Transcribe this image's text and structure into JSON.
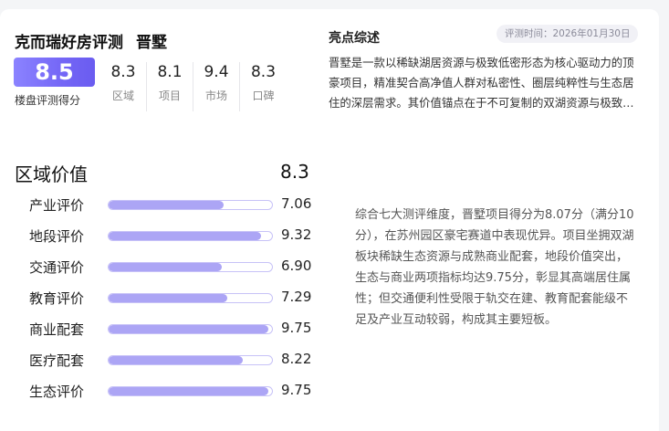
{
  "header": {
    "title": "克而瑞好房评测",
    "project": "晋墅",
    "overall_score": "8.5",
    "overall_caption": "楼盘评测得分",
    "subscores": [
      {
        "value": "8.3",
        "label": "区域"
      },
      {
        "value": "8.1",
        "label": "项目"
      },
      {
        "value": "9.4",
        "label": "市场"
      },
      {
        "value": "8.3",
        "label": "口碑"
      }
    ]
  },
  "highlights": {
    "title": "亮点综述",
    "eval_time": "评测时间：2026年01月30日",
    "text": "晋墅是一款以稀缺湖居资源与极致低密形态为核心驱动力的顶豪项目，精准契合高净值人群对私密性、圈层纯粹性与生态居住的深层需求。其价值锚点在于不可复制的双湖资源与极致低密形态，构筑了难以复制的稀缺价值。"
  },
  "region": {
    "title": "区域价值",
    "score": "8.3",
    "metrics": [
      {
        "label": "产业评价",
        "value": "7.06",
        "ratio": 0.706
      },
      {
        "label": "地段评价",
        "value": "9.32",
        "ratio": 0.932
      },
      {
        "label": "交通评价",
        "value": "6.90",
        "ratio": 0.69
      },
      {
        "label": "教育评价",
        "value": "7.29",
        "ratio": 0.729
      },
      {
        "label": "商业配套",
        "value": "9.75",
        "ratio": 0.975
      },
      {
        "label": "医疗配套",
        "value": "8.22",
        "ratio": 0.822
      },
      {
        "label": "生态评价",
        "value": "9.75",
        "ratio": 0.975
      }
    ],
    "summary": "综合七大测评维度，晋墅项目得分为8.07分（满分10分），在苏州园区豪宅赛道中表现优异。项目坐拥双湖板块稀缺生态资源与成熟商业配套，地段价值突出，生态与商业两项指标均达9.75分，彰显其高端居住属性；但交通便利性受限于轨交在建、教育配套能级不足及产业互动较弱，构成其主要短板。"
  },
  "colors": {
    "accent": "#7466f6",
    "bar_fill": "#aca5f5",
    "bar_border": "#c7c2f7"
  }
}
